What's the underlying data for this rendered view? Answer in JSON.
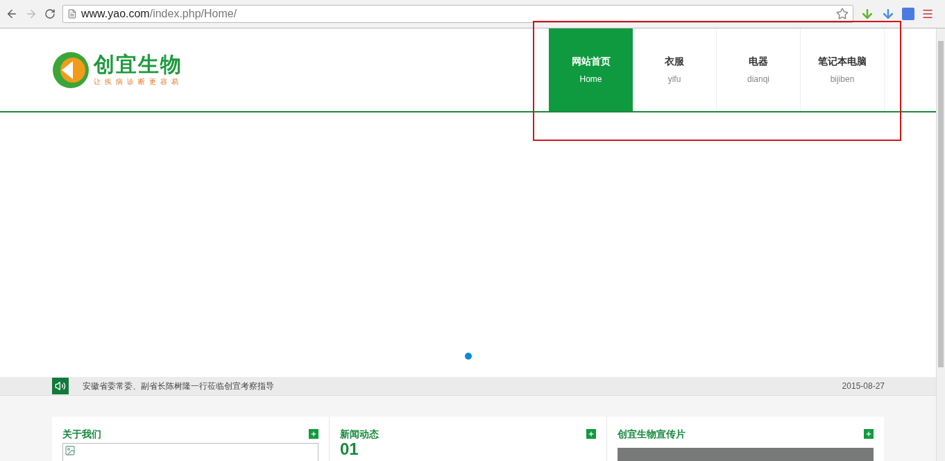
{
  "browser": {
    "url_host": "www.yao.com",
    "url_path": "/index.php/Home/"
  },
  "logo": {
    "name": "创宜生物",
    "tagline": "让疾病诊断更容易"
  },
  "nav": [
    {
      "title": "网站首页",
      "subtitle": "Home",
      "selected": true
    },
    {
      "title": "衣服",
      "subtitle": "yifu",
      "selected": false
    },
    {
      "title": "电器",
      "subtitle": "dianqi",
      "selected": false
    },
    {
      "title": "笔记本电脑",
      "subtitle": "bijiben",
      "selected": false
    }
  ],
  "slider": {
    "dots": [
      {
        "selected": true
      }
    ]
  },
  "notice": {
    "text": "安徽省委常委、副省长陈树隆一行莅临创宜考察指导",
    "date": "2015-08-27"
  },
  "sections": [
    {
      "title": "关于我们",
      "kind": "image"
    },
    {
      "title": "新闻动态",
      "kind": "news",
      "number": "01"
    },
    {
      "title": "创宜生物宣传片",
      "kind": "video"
    }
  ]
}
